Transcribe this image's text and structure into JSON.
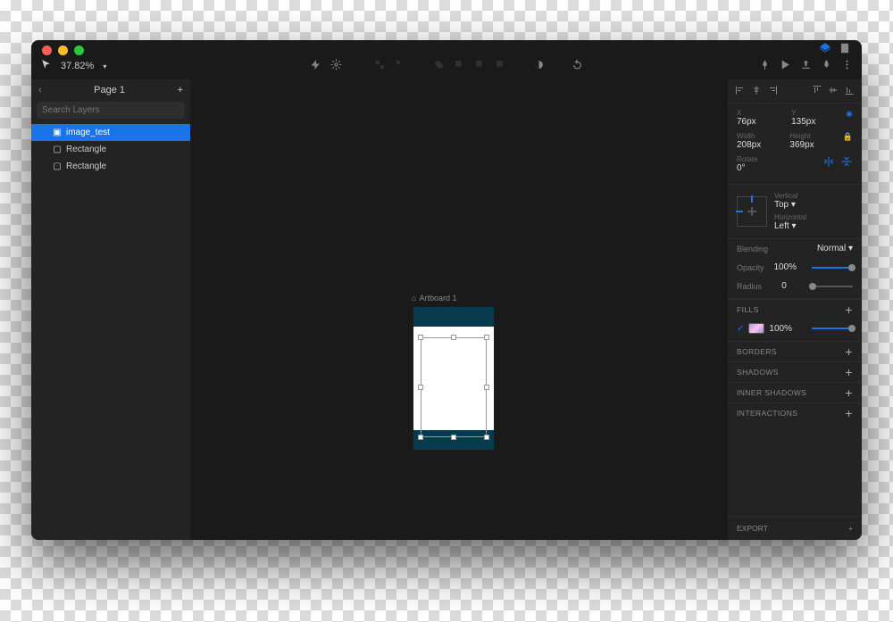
{
  "page": {
    "title": "Page 1"
  },
  "search": {
    "placeholder": "Search Layers"
  },
  "layers": {
    "artboard": "Artboard 1",
    "items": [
      "image_test",
      "Rectangle",
      "Rectangle"
    ]
  },
  "zoom": "37.82%",
  "canvas": {
    "artboard_label": "Artboard 1"
  },
  "inspector": {
    "x": {
      "label": "X",
      "value": "76px"
    },
    "y": {
      "label": "Y",
      "value": "135px"
    },
    "w": {
      "label": "Width",
      "value": "208px"
    },
    "h": {
      "label": "Height",
      "value": "369px"
    },
    "rotate": {
      "label": "Rotate",
      "value": "0°"
    },
    "origin": {
      "v_label": "Vertical",
      "v_value": "Top",
      "h_label": "Horizontal",
      "h_value": "Left"
    },
    "blending": {
      "label": "Blending",
      "value": "Normal"
    },
    "opacity": {
      "label": "Opacity",
      "value": "100%"
    },
    "radius": {
      "label": "Radius",
      "value": "0"
    },
    "sections": {
      "fills": "Fills",
      "borders": "Borders",
      "shadows": "Shadows",
      "inner_shadows": "Inner Shadows",
      "interactions": "Interactions",
      "export": "Export"
    },
    "fill_value": "100%"
  }
}
